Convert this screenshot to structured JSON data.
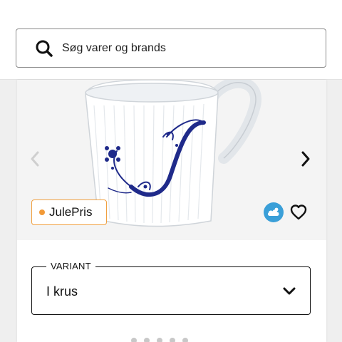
{
  "search": {
    "placeholder": "Søg varer og brands",
    "icon": "search-icon"
  },
  "product": {
    "image_icon": "mug-image",
    "badge_label": "JulePris",
    "badge_color": "#f29a38",
    "climate_icon": "cloud-climate-icon",
    "favorite_icon": "heart-icon"
  },
  "gallery": {
    "prev_icon": "chevron-left-icon",
    "next_icon": "chevron-right-icon"
  },
  "variant": {
    "label": "VARIANT",
    "selected": "I krus"
  },
  "colors": {
    "accent": "#f29a38",
    "climate": "#3a9fd8",
    "pattern_blue": "#1f2a8a"
  }
}
